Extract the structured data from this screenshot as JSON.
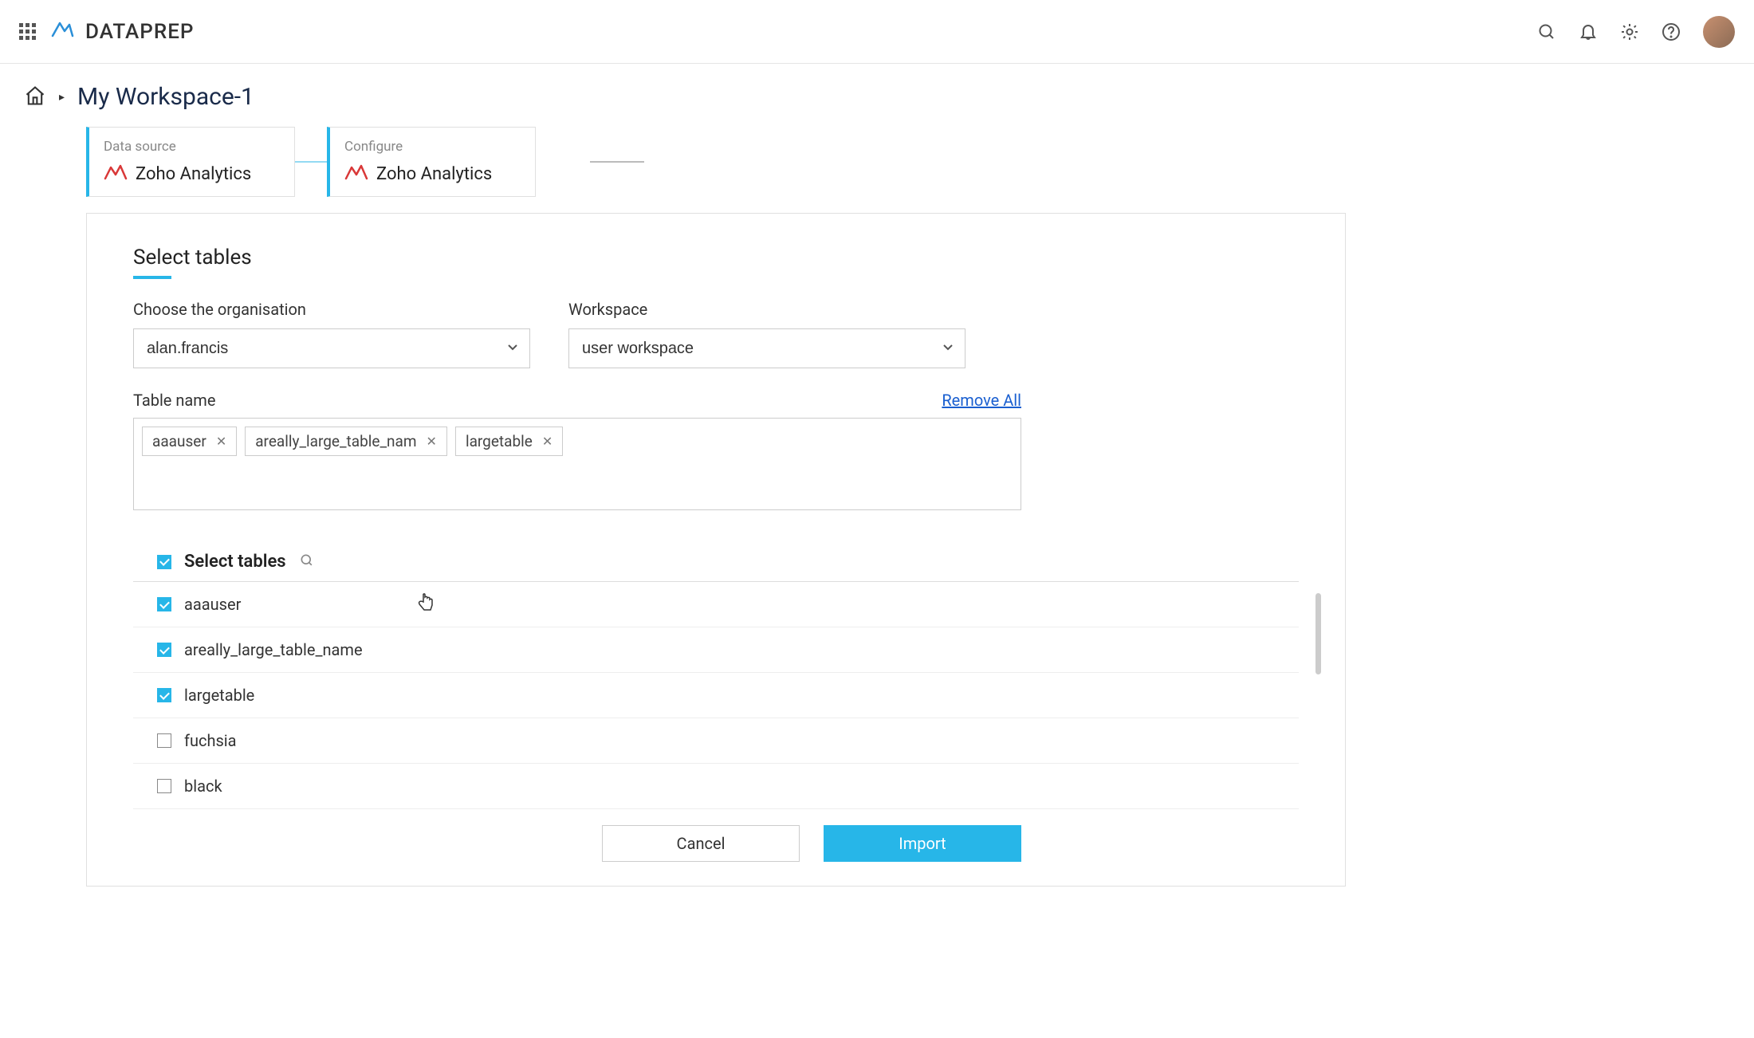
{
  "brand": {
    "name": "DATAPREP"
  },
  "breadcrumb": {
    "workspace": "My Workspace-1"
  },
  "steps": [
    {
      "label": "Data source",
      "source": "Zoho Analytics"
    },
    {
      "label": "Configure",
      "source": "Zoho Analytics"
    }
  ],
  "panel": {
    "title": "Select tables",
    "orgLabel": "Choose the organisation",
    "orgValue": "alan.francis",
    "wsLabel": "Workspace",
    "wsValue": "user workspace",
    "tableNameLabel": "Table name",
    "removeAll": "Remove All",
    "tags": [
      "aaauser",
      "areally_large_table_nam",
      "largetable"
    ],
    "listHeader": "Select tables",
    "tables": [
      {
        "name": "aaauser",
        "checked": true
      },
      {
        "name": "areally_large_table_name",
        "checked": true
      },
      {
        "name": "largetable",
        "checked": true
      },
      {
        "name": "fuchsia",
        "checked": false
      },
      {
        "name": "black",
        "checked": false
      }
    ],
    "cancel": "Cancel",
    "import": "Import"
  }
}
